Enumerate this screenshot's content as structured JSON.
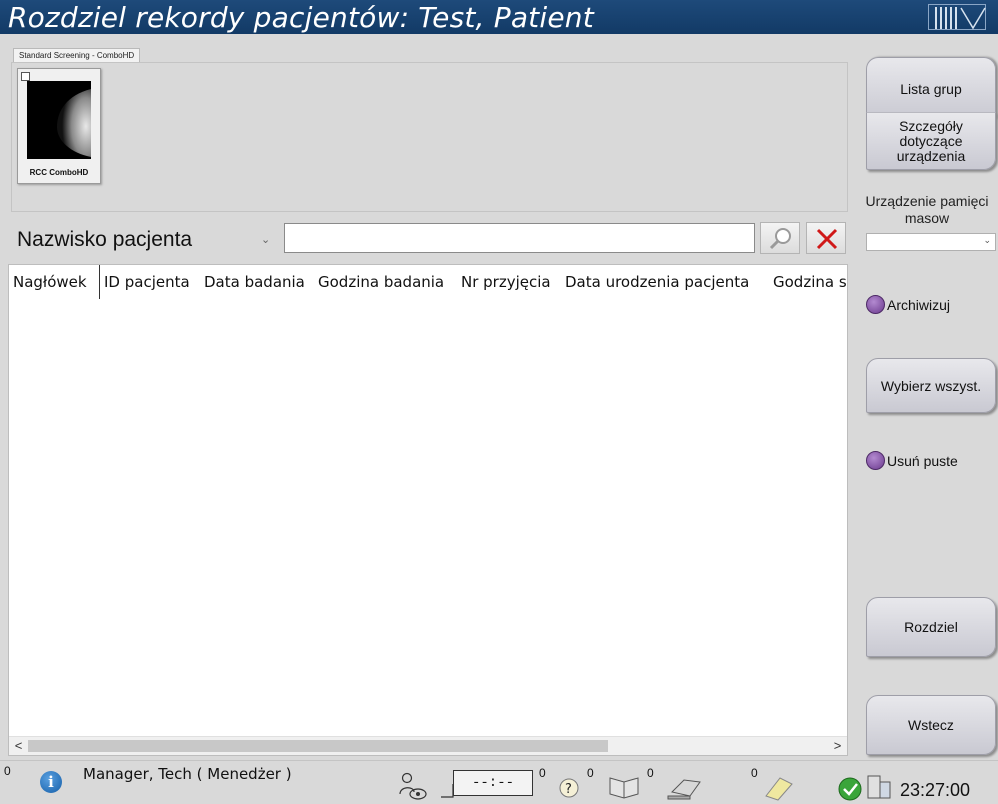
{
  "window": {
    "title": "Rozdziel rekordy pacjentów: Test, Patient"
  },
  "procedure_tab": {
    "label": "Standard Screening - ComboHD"
  },
  "thumbnails": [
    {
      "label": "RCC ComboHD"
    }
  ],
  "search": {
    "field_selected": "Nazwisko pacjenta",
    "query_value": "",
    "placeholder": ""
  },
  "table": {
    "columns": [
      "Nagłówek",
      "ID pacjenta",
      "Data badania",
      "Godzina badania",
      "Nr przyjęcia",
      "Data urodzenia pacjenta",
      "Godzina se"
    ],
    "rows": []
  },
  "sidebar": {
    "lista_grup": "Lista grup",
    "szczegoly": "Szczegóły dotyczące urządzenia",
    "device_label": "Urządzenie pamięci masow",
    "device_value": "",
    "archiwizuj": "Archiwizuj",
    "wybierz": "Wybierz wszyst.",
    "usun_puste": "Usuń puste",
    "rozdziel": "Rozdziel",
    "wstecz": "Wstecz"
  },
  "statusbar": {
    "alert_count": "0",
    "user": "Manager, Tech ( Menedżer )",
    "timer": "--:--",
    "count_timer": "0",
    "count_help": "0",
    "count_output": "0",
    "count_print": "0",
    "time": "23:27:00"
  },
  "colors": {
    "titlebar": "#1e4a7a",
    "radio": "#7a4a9e",
    "clear_x": "#d01818"
  }
}
